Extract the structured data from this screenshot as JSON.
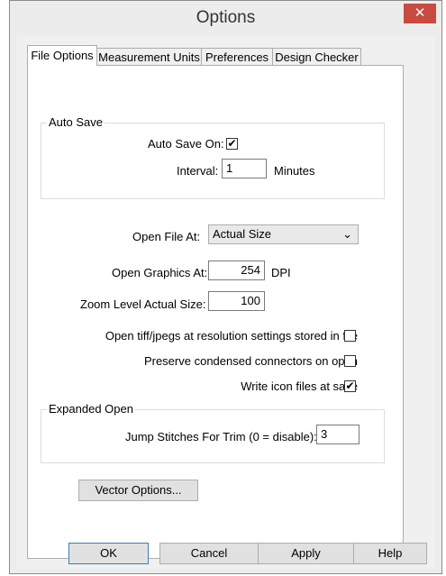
{
  "window": {
    "title": "Options",
    "close_glyph": "✕"
  },
  "tabs": [
    {
      "label": "File Options",
      "active": true
    },
    {
      "label": "Measurement Units",
      "active": false
    },
    {
      "label": "Preferences",
      "active": false
    },
    {
      "label": "Design Checker",
      "active": false
    }
  ],
  "auto_save": {
    "group_title": "Auto Save",
    "enabled_label": "Auto Save On:",
    "enabled": true,
    "interval_label": "Interval:",
    "interval_value": "1",
    "interval_unit": "Minutes"
  },
  "open_file": {
    "label": "Open File At:",
    "selected": "Actual Size"
  },
  "open_graphics": {
    "label": "Open Graphics At:",
    "value": "254",
    "unit": "DPI"
  },
  "zoom_level": {
    "label": "Zoom Level Actual Size:",
    "value": "100"
  },
  "options": {
    "tiff_label": "Open tiff/jpegs at resolution settings stored in file",
    "tiff_checked": false,
    "preserve_label": "Preserve condensed connectors on open",
    "preserve_checked": false,
    "write_icon_label": "Write icon files at save",
    "write_icon_checked": true
  },
  "expanded_open": {
    "group_title": "Expanded Open",
    "jump_label": "Jump Stitches For Trim (0 = disable):",
    "jump_value": "3"
  },
  "vector_options_label": "Vector Options...",
  "footer": {
    "ok": "OK",
    "cancel": "Cancel",
    "apply": "Apply",
    "help": "Help"
  },
  "check_glyph": "✔"
}
